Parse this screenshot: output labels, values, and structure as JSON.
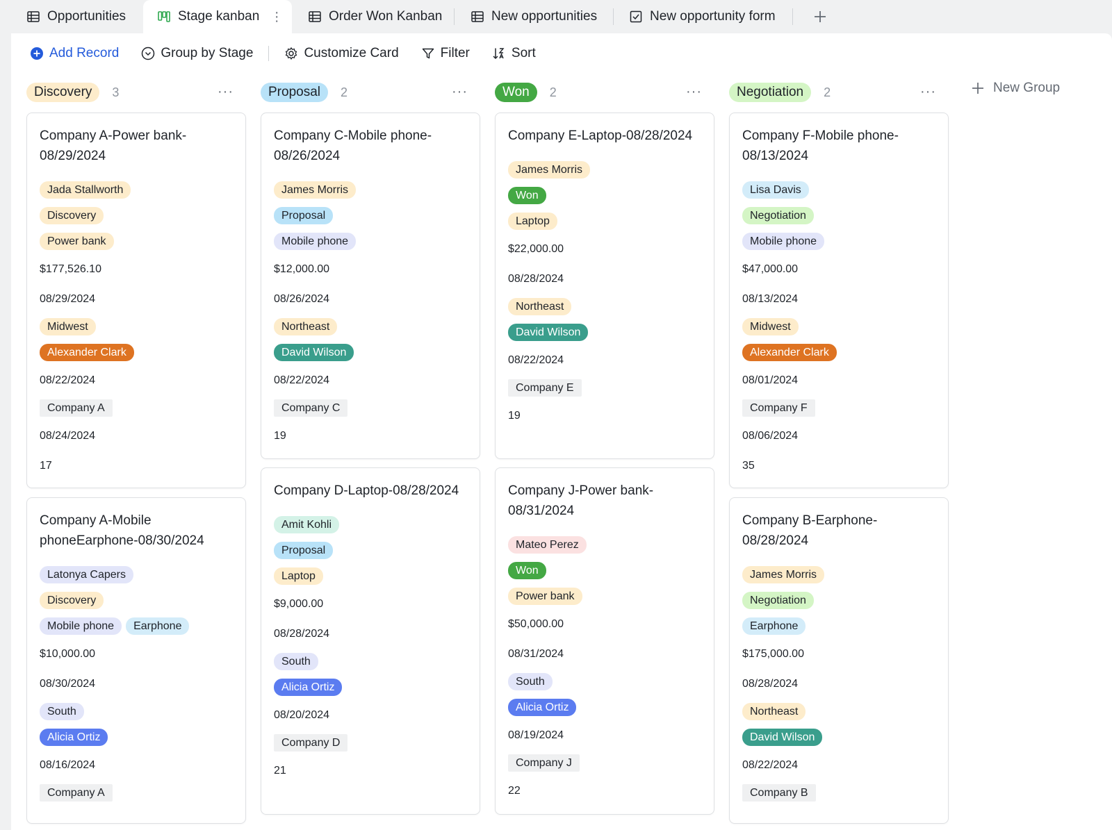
{
  "tabs": [
    {
      "label": "Opportunities",
      "icon": "grid-table-icon"
    },
    {
      "label": "Stage kanban",
      "icon": "kanban-icon",
      "active": true,
      "more": "⋮"
    },
    {
      "label": "Order Won Kanban",
      "icon": "grid-table-icon"
    },
    {
      "label": "New opportunities",
      "icon": "grid-table-icon"
    },
    {
      "label": "New opportunity form",
      "icon": "form-icon"
    }
  ],
  "toolbar": {
    "add_record": "Add Record",
    "group_by": "Group by Stage",
    "customize_card": "Customize Card",
    "filter": "Filter",
    "sort": "Sort"
  },
  "new_group": "New Group",
  "colors": {
    "accent": "#245bdb",
    "discovery_bg": "#fdeccb",
    "proposal_bg": "#b8e2f8",
    "won_bg": "#44a844",
    "negotiation_bg": "#d4f5c5"
  },
  "columns": [
    {
      "name": "Discovery",
      "count": "3",
      "more": "···",
      "cards": [
        {
          "title": "Company A-Power bank-08/29/2024",
          "owner": "Jada Stallworth",
          "stage": "Discovery",
          "products": [
            "Power bank"
          ],
          "amount": "$177,526.10",
          "date1": "08/29/2024",
          "region": "Midwest",
          "manager": "Alexander Clark",
          "date2": "08/22/2024",
          "company": "Company A",
          "date3": "08/24/2024",
          "number": "17"
        },
        {
          "title": "Company A-Mobile phoneEarphone-08/30/2024",
          "owner": "Latonya Capers",
          "stage": "Discovery",
          "products": [
            "Mobile phone",
            "Earphone"
          ],
          "amount": "$10,000.00",
          "date1": "08/30/2024",
          "region": "South",
          "manager": "Alicia Ortiz",
          "date2": "08/16/2024",
          "company": "Company A",
          "date3": "",
          "number": ""
        }
      ]
    },
    {
      "name": "Proposal",
      "count": "2",
      "more": "···",
      "cards": [
        {
          "title": "Company C-Mobile phone-08/26/2024",
          "owner": "James Morris",
          "stage": "Proposal",
          "products": [
            "Mobile phone"
          ],
          "amount": "$12,000.00",
          "date1": "08/26/2024",
          "region": "Northeast",
          "manager": "David Wilson",
          "date2": "08/22/2024",
          "company": "Company C",
          "number": "19"
        },
        {
          "title": "Company D-Laptop-08/28/2024",
          "owner": "Amit Kohli",
          "stage": "Proposal",
          "products": [
            "Laptop"
          ],
          "amount": "$9,000.00",
          "date1": "08/28/2024",
          "region": "South",
          "manager": "Alicia Ortiz",
          "date2": "08/20/2024",
          "company": "Company D",
          "number": "21"
        }
      ]
    },
    {
      "name": "Won",
      "count": "2",
      "more": "···",
      "cards": [
        {
          "title": "Company E-Laptop-08/28/2024",
          "owner": "James Morris",
          "stage": "Won",
          "products": [
            "Laptop"
          ],
          "amount": "$22,000.00",
          "date1": "08/28/2024",
          "region": "Northeast",
          "manager": "David Wilson",
          "date2": "08/22/2024",
          "company": "Company E",
          "number": "19"
        },
        {
          "title": "Company J-Power bank-08/31/2024",
          "owner": "Mateo Perez",
          "stage": "Won",
          "products": [
            "Power bank"
          ],
          "amount": "$50,000.00",
          "date1": "08/31/2024",
          "region": "South",
          "manager": "Alicia Ortiz",
          "date2": "08/19/2024",
          "company": "Company J",
          "number": "22"
        }
      ]
    },
    {
      "name": "Negotiation",
      "count": "2",
      "more": "···",
      "cards": [
        {
          "title": "Company F-Mobile phone-08/13/2024",
          "owner": "Lisa Davis",
          "stage": "Negotiation",
          "products": [
            "Mobile phone"
          ],
          "amount": "$47,000.00",
          "date1": "08/13/2024",
          "region": "Midwest",
          "manager": "Alexander Clark",
          "date2": "08/01/2024",
          "company": "Company F",
          "date3": "08/06/2024",
          "number": "35"
        },
        {
          "title": "Company B-Earphone-08/28/2024",
          "owner": "James Morris",
          "stage": "Negotiation",
          "products": [
            "Earphone"
          ],
          "amount": "$175,000.00",
          "date1": "08/28/2024",
          "region": "Northeast",
          "manager": "David Wilson",
          "date2": "08/22/2024",
          "company": "Company B"
        }
      ]
    }
  ]
}
